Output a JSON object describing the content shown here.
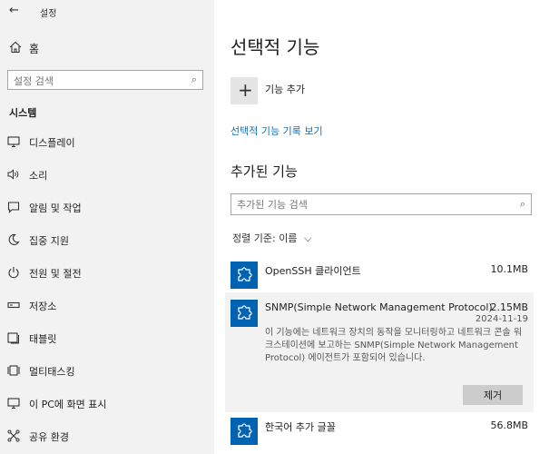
{
  "window": {
    "back_glyph": "←",
    "title": "설정"
  },
  "sidebar": {
    "home_label": "홈",
    "search_placeholder": "설정 검색",
    "section_title": "시스템",
    "items": [
      {
        "label": "디스플레이",
        "icon": "display-icon"
      },
      {
        "label": "소리",
        "icon": "sound-icon"
      },
      {
        "label": "알림 및 작업",
        "icon": "notification-icon"
      },
      {
        "label": "집중 지원",
        "icon": "focus-assist-icon"
      },
      {
        "label": "전원 및 절전",
        "icon": "power-icon"
      },
      {
        "label": "저장소",
        "icon": "storage-icon"
      },
      {
        "label": "태블릿",
        "icon": "tablet-icon"
      },
      {
        "label": "멀티태스킹",
        "icon": "multitasking-icon"
      },
      {
        "label": "이 PC에 화면 표시",
        "icon": "project-icon"
      },
      {
        "label": "공유 환경",
        "icon": "shared-experiences-icon"
      }
    ]
  },
  "main": {
    "title": "선택적 기능",
    "add_feature_label": "기능 추가",
    "history_link": "선택적 기능 기록 보기",
    "installed_title": "추가된 기능",
    "search_placeholder": "추가된 기능 검색",
    "sort_label": "정렬 기준:",
    "sort_value": "이름",
    "features": [
      {
        "name": "OpenSSH 클라이언트",
        "size": "10.1MB"
      },
      {
        "name": "SNMP(Simple Network Management Protocol)",
        "size": "2.15MB",
        "date": "2024-11-19",
        "description": "이 기능에는 네트워크 장치의 동작을 모니터링하고 네트워크 콘솔 워크스테이션에 보고하는 SNMP(Simple Network Management Protocol) 에이전트가 포함되어 있습니다.",
        "remove_label": "제거"
      },
      {
        "name": "한국어 추가 글꼴",
        "size": "56.8MB"
      }
    ]
  },
  "colors": {
    "accent": "#0063b1",
    "link": "#1a6fb3",
    "sidebar_bg": "#f2f2f2"
  }
}
